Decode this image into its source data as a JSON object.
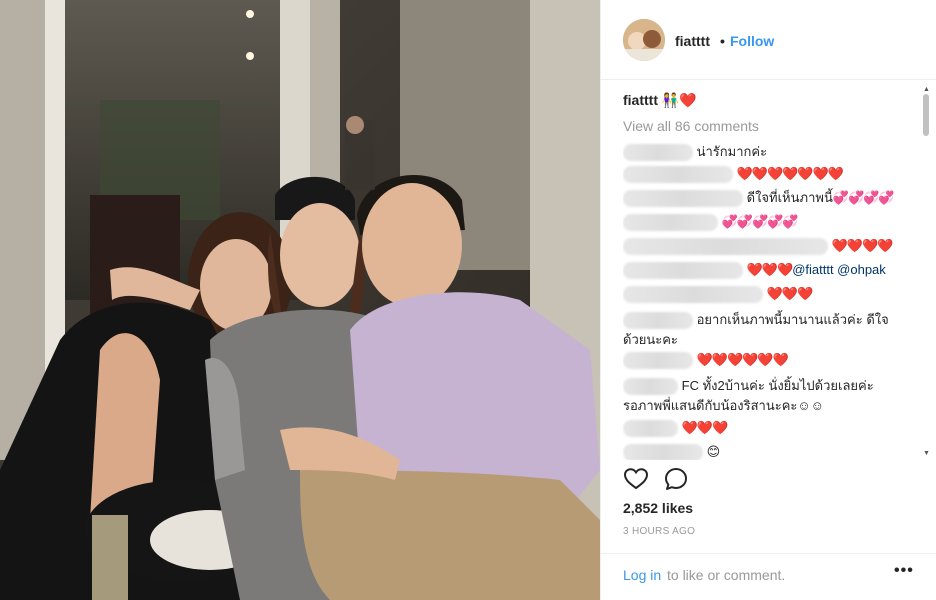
{
  "post": {
    "username": "fiatttt",
    "separator": "•",
    "follow_label": "Follow",
    "caption_emoji": "👫❤️",
    "view_all_comments": "View all 86 comments",
    "likes": "2,852 likes",
    "timestamp": "3 HOURS AGO",
    "login_link": "Log in",
    "login_rest": "to like or comment.",
    "more_label": "•••"
  },
  "comments": [
    {
      "text": "น่ารักมากค่ะ",
      "suffix": ""
    },
    {
      "text": "",
      "suffix": "❤️❤️❤️❤️❤️❤️❤️"
    },
    {
      "text": "ดีใจที่เห็นภาพนี้",
      "suffix": "💞💞💞💞"
    },
    {
      "text": "",
      "suffix": "💞💞💞💞💞"
    },
    {
      "text": "",
      "suffix": "❤️❤️❤️❤️"
    },
    {
      "text": "@fiatttt @ohpak",
      "suffix": "❤️❤️❤️"
    },
    {
      "text": "",
      "suffix": "❤️❤️❤️"
    },
    {
      "text": "อยากเห็นภาพนี้มานานแล้วค่ะ ดีใจ",
      "line2": "ด้วยนะคะ"
    },
    {
      "text": "",
      "suffix": "❤️❤️❤️❤️❤️❤️"
    },
    {
      "text": "FC ทั้ง2บ้านค่ะ นั่งยิ้มไปด้วยเลยค่ะ",
      "line2": "รอภาพพี่แสนดีกับน้องริสานะคะ☺☺"
    },
    {
      "text": "",
      "suffix": "❤️❤️❤️"
    },
    {
      "text": "",
      "suffix": "😊"
    }
  ]
}
